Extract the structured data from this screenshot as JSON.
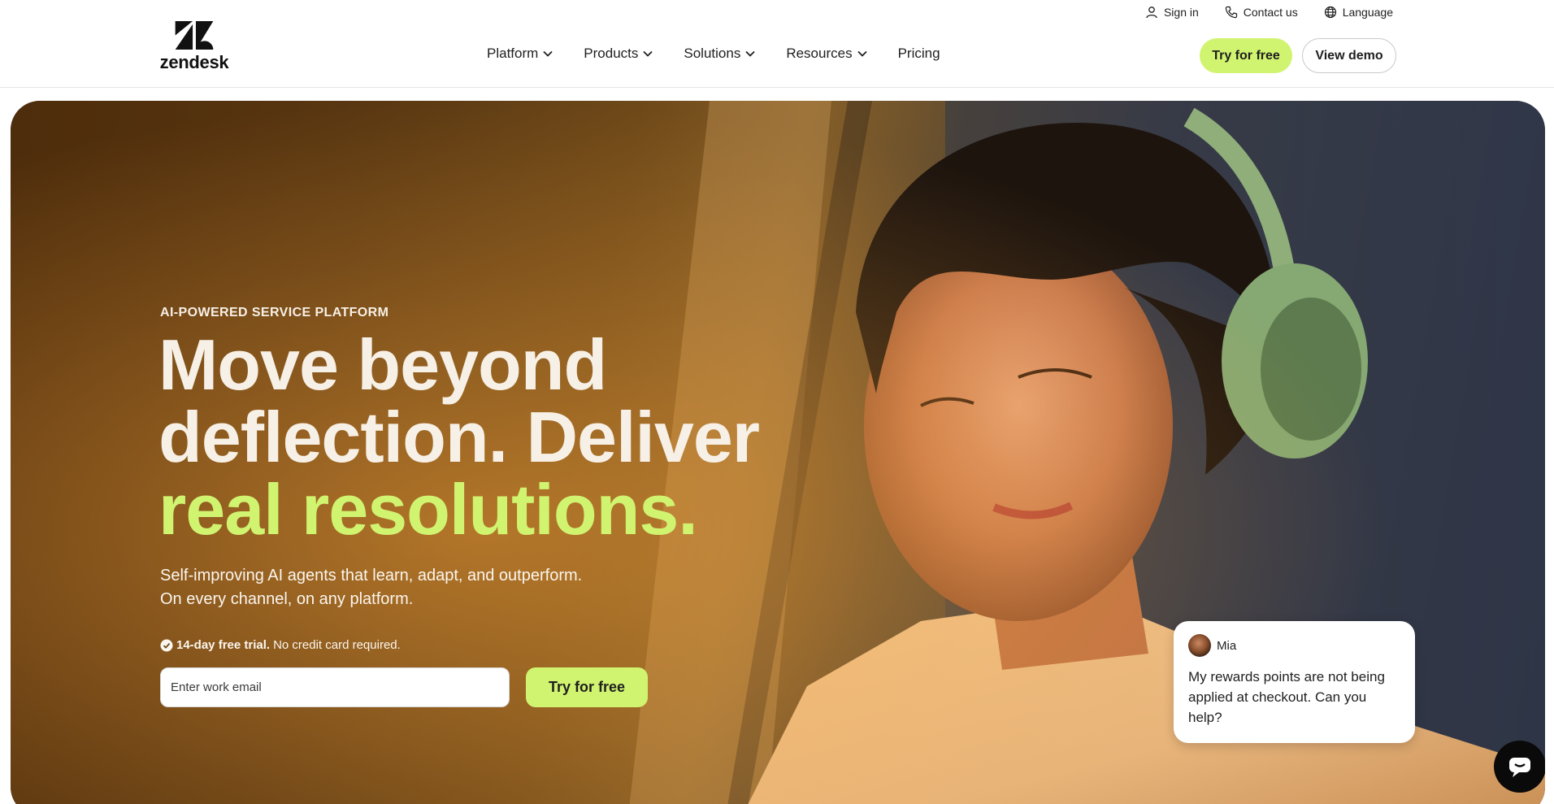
{
  "header": {
    "logo_text": "zendesk",
    "utility": [
      {
        "label": "Sign in",
        "icon": "user-icon"
      },
      {
        "label": "Contact us",
        "icon": "phone-icon"
      },
      {
        "label": "Language",
        "icon": "globe-icon"
      }
    ],
    "nav": [
      {
        "label": "Platform",
        "has_dropdown": true
      },
      {
        "label": "Products",
        "has_dropdown": true
      },
      {
        "label": "Solutions",
        "has_dropdown": true
      },
      {
        "label": "Resources",
        "has_dropdown": true
      },
      {
        "label": "Pricing",
        "has_dropdown": false
      }
    ],
    "try_free": "Try for free",
    "view_demo": "View demo"
  },
  "hero": {
    "eyebrow": "AI-POWERED SERVICE PLATFORM",
    "headline_line1": "Move beyond",
    "headline_line2": "deflection. Deliver",
    "headline_accent": "real resolutions.",
    "subhead_line1": "Self-improving AI agents that learn, adapt, and outperform.",
    "subhead_line2": "On every channel, on any platform.",
    "trial_bold": "14-day free trial.",
    "trial_rest": "No credit card required.",
    "email_placeholder": "Enter work email",
    "try_free": "Try for free"
  },
  "chat": {
    "name": "Mia",
    "message": "My rewards points are not being applied at checkout. Can you help?"
  },
  "colors": {
    "accent": "#d1f470",
    "dark": "#1f1f1f",
    "hero_text": "#f7f0e6"
  }
}
